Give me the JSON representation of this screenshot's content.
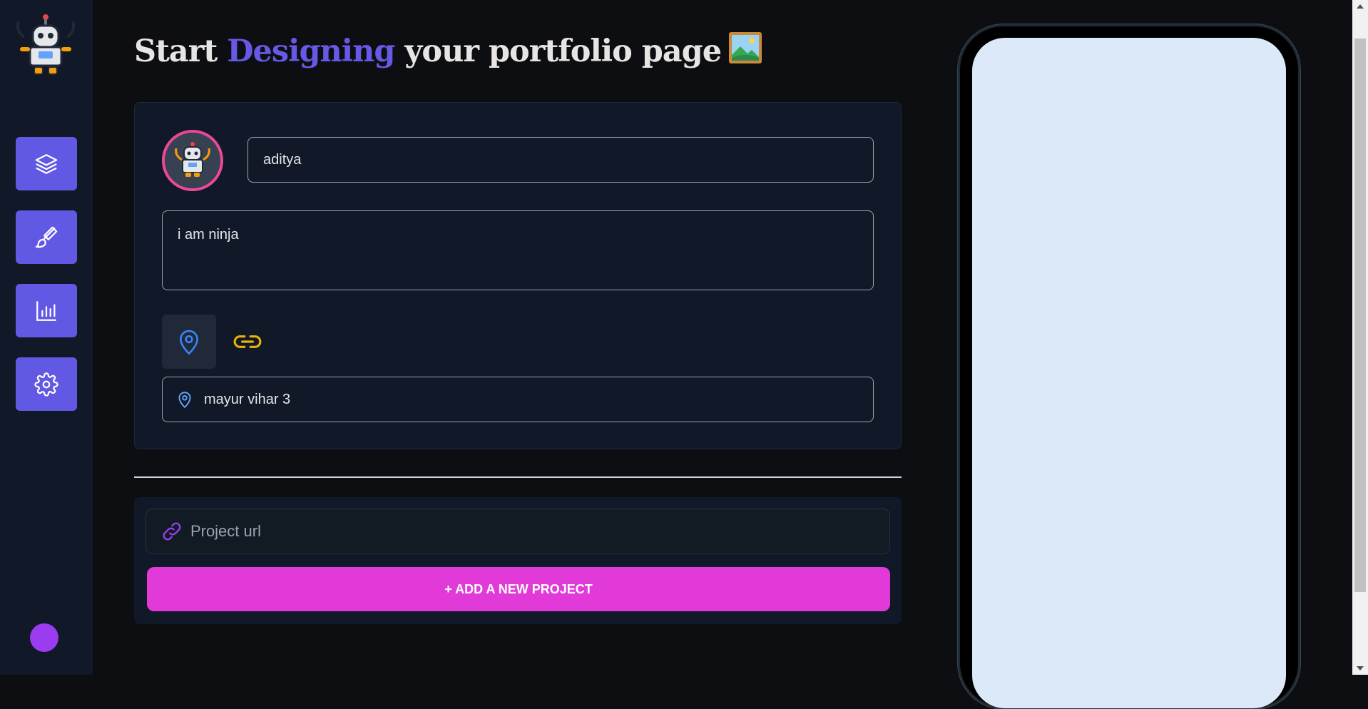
{
  "title": {
    "part1": "Start ",
    "accent": "Designing",
    "part2": " your portfolio page"
  },
  "sidebar": {
    "items": [
      {
        "icon": "layers-icon",
        "name": "sidebar-item-layers"
      },
      {
        "icon": "brush-icon",
        "name": "sidebar-item-design"
      },
      {
        "icon": "bar-chart-icon",
        "name": "sidebar-item-analytics"
      },
      {
        "icon": "gear-icon",
        "name": "sidebar-item-settings"
      }
    ],
    "accent_color": "#6158e3"
  },
  "profile": {
    "name_value": "aditya",
    "bio_value": "i am ninja",
    "location_value": "mayur vihar 3"
  },
  "project": {
    "url_placeholder": "Project url",
    "add_button_label": "+ ADD A NEW PROJECT",
    "button_color": "#e13ad8"
  },
  "phone_preview": {
    "screen_color": "#dbe9f8"
  }
}
